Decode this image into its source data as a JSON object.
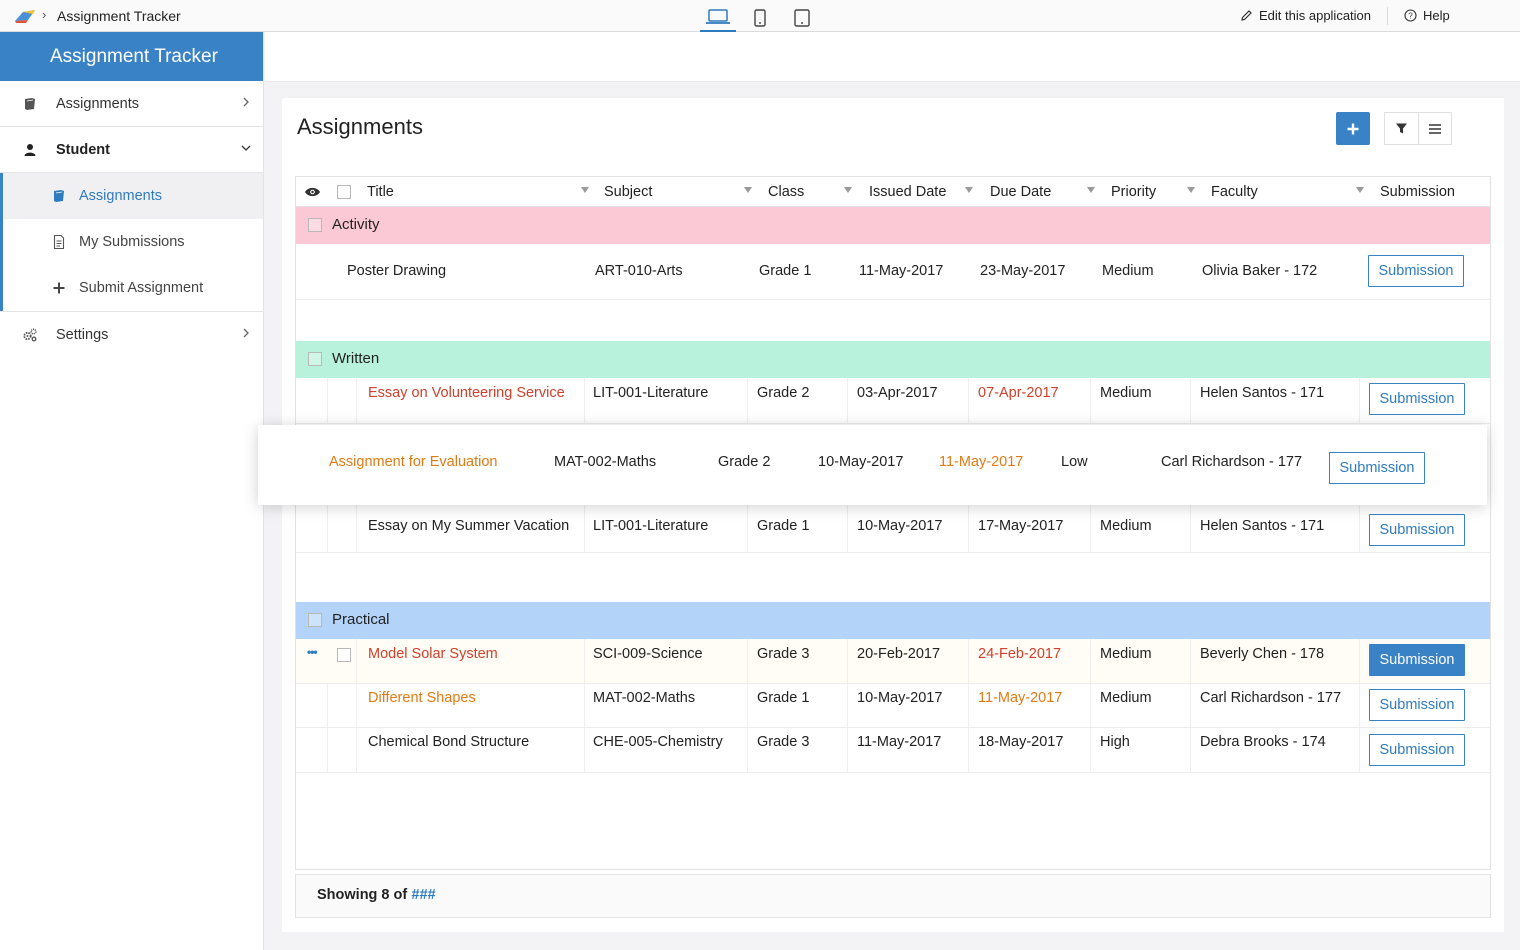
{
  "topbar": {
    "title": "Assignment Tracker",
    "separator": "›",
    "edit_label": "Edit this application",
    "help_label": "Help"
  },
  "sidebar": {
    "app_name": "Assignment Tracker",
    "items": [
      {
        "label": "Assignments",
        "icon": "book-icon"
      },
      {
        "label": "Student",
        "icon": "user-icon"
      },
      {
        "label": "Settings",
        "icon": "gears-icon"
      }
    ],
    "student_sub": [
      {
        "label": "Assignments",
        "icon": "book-icon"
      },
      {
        "label": "My Submissions",
        "icon": "document-icon"
      },
      {
        "label": "Submit Assignment",
        "icon": "plus-icon"
      }
    ]
  },
  "main": {
    "title": "Assignments",
    "columns": [
      "Title",
      "Subject",
      "Class",
      "Issued Date",
      "Due Date",
      "Priority",
      "Faculty",
      "Submission"
    ],
    "groups": {
      "activity": "Activity",
      "written": "Written",
      "practical": "Practical"
    },
    "rows": [
      {
        "title": "Poster Drawing",
        "subject": "ART-010-Arts",
        "class": "Grade 1",
        "issued": "11-May-2017",
        "due": "23-May-2017",
        "priority": "Medium",
        "faculty": "Olivia Baker - 172",
        "action": "Submission"
      },
      {
        "title": "Essay on Volunteering Service",
        "subject": "LIT-001-Literature",
        "class": "Grade 2",
        "issued": "03-Apr-2017",
        "due": "07-Apr-2017",
        "priority": "Medium",
        "faculty": "Helen Santos - 171",
        "action": "Submission"
      },
      {
        "title": "Assignment for Evaluation",
        "subject": "MAT-002-Maths",
        "class": "Grade 2",
        "issued": "10-May-2017",
        "due": "11-May-2017",
        "priority": "Low",
        "faculty": "Carl Richardson - 177",
        "action": "Submission"
      },
      {
        "title": "Essay on My Summer Vacation",
        "subject": "LIT-001-Literature",
        "class": "Grade 1",
        "issued": "10-May-2017",
        "due": "17-May-2017",
        "priority": "Medium",
        "faculty": "Helen Santos - 171",
        "action": "Submission"
      },
      {
        "title": "Model Solar System",
        "subject": "SCI-009-Science",
        "class": "Grade 3",
        "issued": "20-Feb-2017",
        "due": "24-Feb-2017",
        "priority": "Medium",
        "faculty": "Beverly Chen - 178",
        "action": "Submission"
      },
      {
        "title": "Different Shapes",
        "subject": "MAT-002-Maths",
        "class": "Grade 1",
        "issued": "10-May-2017",
        "due": "11-May-2017",
        "priority": "Medium",
        "faculty": "Carl Richardson - 177",
        "action": "Submission"
      },
      {
        "title": "Chemical Bond Structure",
        "subject": "CHE-005-Chemistry",
        "class": "Grade 3",
        "issued": "11-May-2017",
        "due": "18-May-2017",
        "priority": "High",
        "faculty": "Debra Brooks - 174",
        "action": "Submission"
      }
    ],
    "footer": {
      "showing": "Showing 8 of",
      "total": "###"
    },
    "row_menu": "•••"
  },
  "colors": {
    "accent": "#3a82c6",
    "activity_bg": "#fbc9d6",
    "written_bg": "#b8f2dc",
    "practical_bg": "#b3d4f8",
    "overdue_text": "#d0402b",
    "due_soon_text": "#e07b14"
  }
}
